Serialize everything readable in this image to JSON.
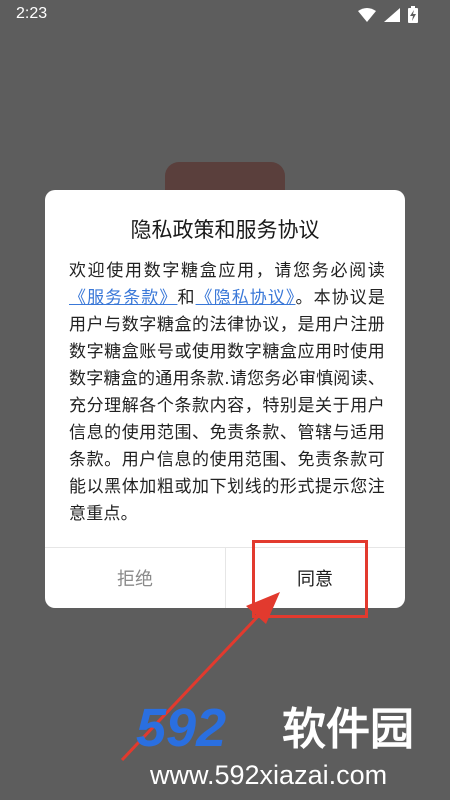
{
  "status_bar": {
    "time": "2:23",
    "icons": [
      "wifi-icon",
      "signal-icon",
      "battery-charging-icon"
    ]
  },
  "dialog": {
    "title": "隐私政策和服务协议",
    "body_part1": "欢迎使用数字糖盒应用，请您务必阅读",
    "link_terms": "《服务条款》",
    "body_and": "和",
    "link_privacy": "《隐私协议》",
    "body_part2": "。本协议是用户与数字糖盒的法律协议，是用户注册数字糖盒账号或使用数字糖盒应用时使用数字糖盒的通用条款.请您务必审慎阅读、充分理解各个条款内容，特别是关于用户信息的使用范围、免责条款、管辖与适用条款。用户信息的使用范围、免责条款可能以黑体加粗或加下划线的形式提示您注意重点。",
    "reject_label": "拒绝",
    "agree_label": "同意"
  },
  "watermark": {
    "brand_number": "592",
    "brand_text": "软件园",
    "url": "www.592xiazai.com"
  },
  "colors": {
    "link": "#3a78d8",
    "highlight": "#e23a2e",
    "watermark_blue": "#2a6fe0",
    "overlay_bg": "#5d5d5d"
  }
}
